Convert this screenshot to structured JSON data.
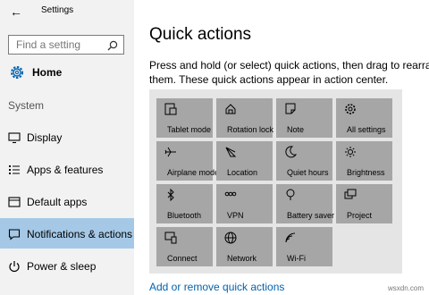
{
  "window": {
    "title": "Settings",
    "back_glyph": "←"
  },
  "sidebar": {
    "search_placeholder": "Find a setting",
    "home_label": "Home",
    "section_label": "System",
    "items": [
      {
        "label": "Display",
        "icon": "display-icon"
      },
      {
        "label": "Apps & features",
        "icon": "apps-list-icon"
      },
      {
        "label": "Default apps",
        "icon": "default-apps-icon"
      },
      {
        "label": "Notifications & actions",
        "icon": "notifications-icon",
        "selected": true
      },
      {
        "label": "Power & sleep",
        "icon": "power-icon"
      }
    ]
  },
  "main": {
    "title": "Quick actions",
    "description_line1": "Press and hold (or select) quick actions, then drag to rearrange",
    "description_line2": "them. These quick actions appear in action center.",
    "tiles": [
      {
        "label": "Tablet mode",
        "icon": "tablet-mode-icon"
      },
      {
        "label": "Rotation lock",
        "icon": "rotation-lock-icon"
      },
      {
        "label": "Note",
        "icon": "note-icon"
      },
      {
        "label": "All settings",
        "icon": "gear-icon"
      },
      {
        "label": "Airplane mode",
        "icon": "airplane-icon"
      },
      {
        "label": "Location",
        "icon": "location-icon"
      },
      {
        "label": "Quiet hours",
        "icon": "moon-icon"
      },
      {
        "label": "Brightness",
        "icon": "brightness-icon"
      },
      {
        "label": "Bluetooth",
        "icon": "bluetooth-icon"
      },
      {
        "label": "VPN",
        "icon": "vpn-icon"
      },
      {
        "label": "Battery saver",
        "icon": "battery-saver-icon"
      },
      {
        "label": "Project",
        "icon": "project-icon"
      },
      {
        "label": "Connect",
        "icon": "connect-icon"
      },
      {
        "label": "Network",
        "icon": "network-globe-icon"
      },
      {
        "label": "Wi-Fi",
        "icon": "wifi-icon"
      }
    ],
    "footer_link": "Add or remove quick actions"
  },
  "watermark": "wsxdn.com",
  "colors": {
    "accent": "#0063b1",
    "selected_nav": "#a5c8e6",
    "tile": "#a6a6a6",
    "sidebar_bg": "#f2f2f2"
  }
}
